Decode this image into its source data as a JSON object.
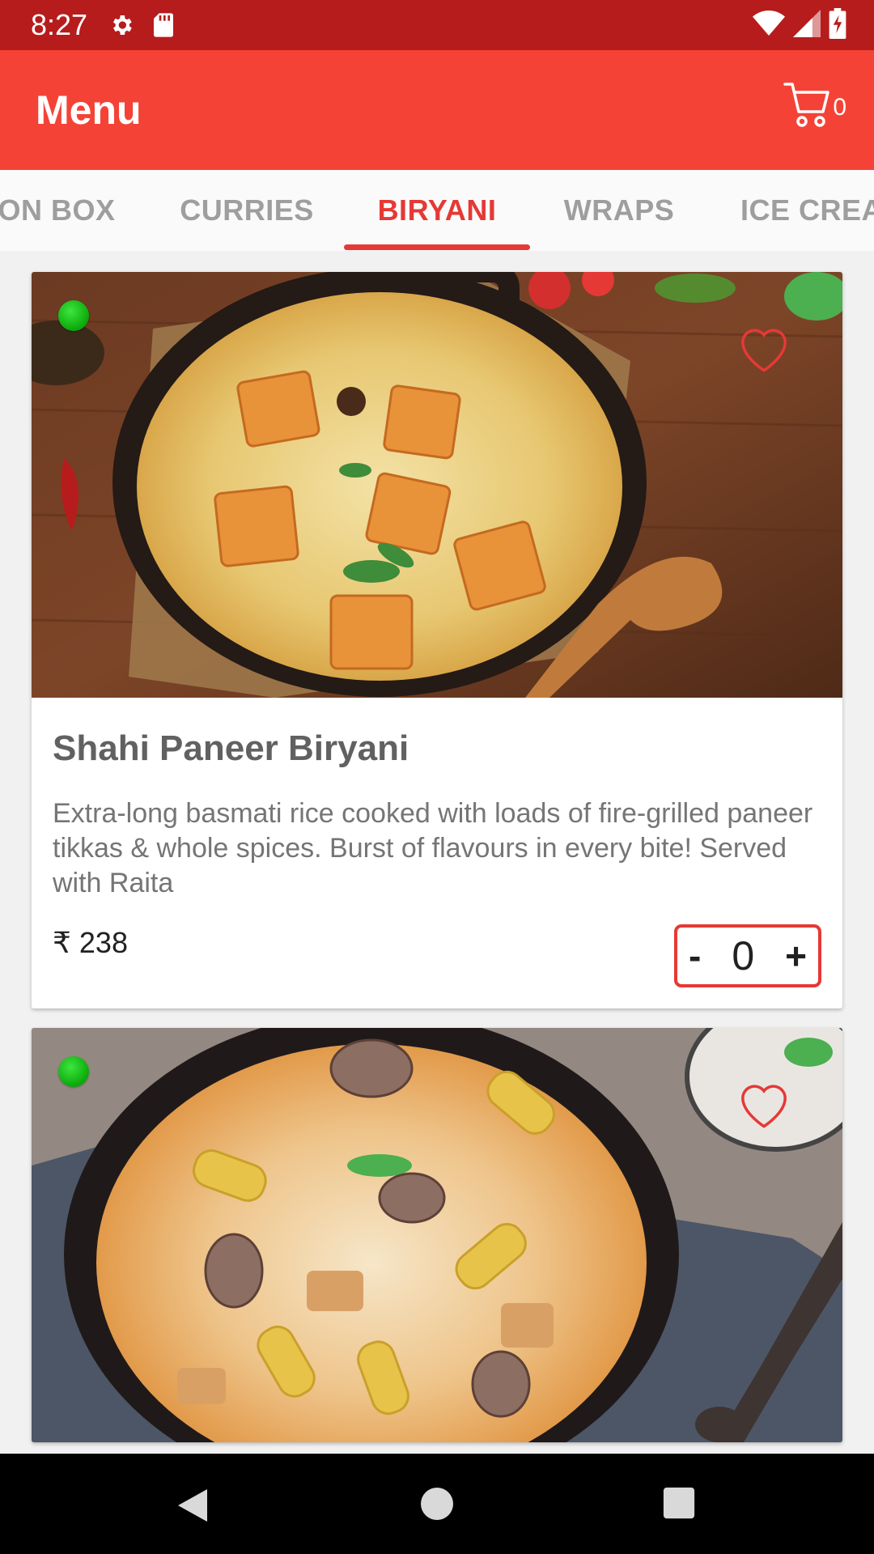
{
  "status_bar": {
    "time": "8:27",
    "icons": [
      "gear-icon",
      "sd-card-icon",
      "wifi-icon",
      "signal-icon",
      "battery-icon"
    ]
  },
  "app_bar": {
    "title": "Menu",
    "cart_count": "0"
  },
  "tabs": [
    {
      "label": "ON BOX",
      "active": false
    },
    {
      "label": "CURRIES",
      "active": false
    },
    {
      "label": "BIRYANI",
      "active": true
    },
    {
      "label": "WRAPS",
      "active": false
    },
    {
      "label": "ICE CREA",
      "active": false
    }
  ],
  "items": [
    {
      "name": "Shahi Paneer Biryani",
      "description": "Extra-long basmati rice cooked with loads of fire-grilled paneer tikkas & whole spices. Burst of flavours in every bite! Served with Raita",
      "price": "₹ 238",
      "quantity": "0",
      "minus_label": "-",
      "plus_label": "+",
      "veg": true
    },
    {
      "veg": true
    }
  ],
  "colors": {
    "primary": "#f44336",
    "primary_dark": "#b71c1c",
    "accent": "#e53935",
    "veg_green": "#11b511"
  }
}
